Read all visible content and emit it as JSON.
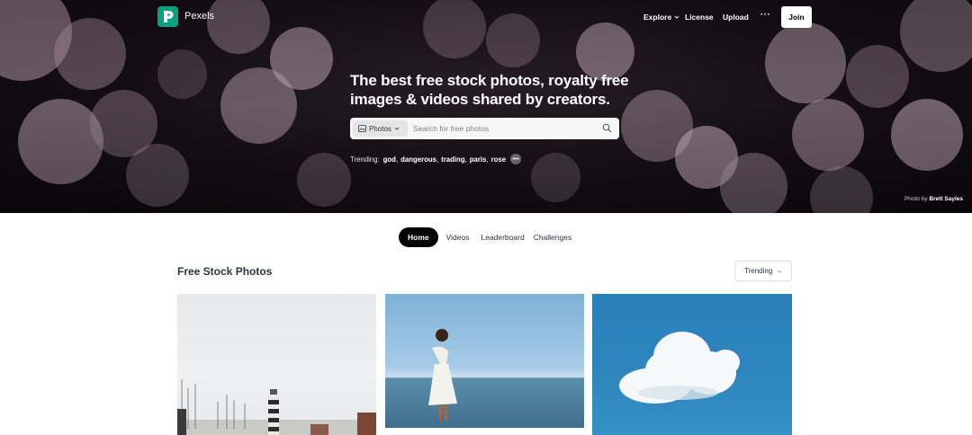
{
  "brand": {
    "name": "Pexels",
    "accent": "#07a081"
  },
  "nav": {
    "explore": "Explore",
    "license": "License",
    "upload": "Upload",
    "more": "···",
    "join": "Join"
  },
  "hero": {
    "title": "The best free stock photos, royalty free images & videos shared by creators.",
    "search": {
      "type_label": "Photos",
      "placeholder": "Search for free photos"
    },
    "trending": {
      "label": "Trending:",
      "terms": [
        "god",
        "dangerous",
        "trading",
        "paris",
        "rose"
      ]
    },
    "credit_prefix": "Photo by",
    "credit_name": "Brett Sayles"
  },
  "tabs": [
    {
      "label": "Home",
      "active": true
    },
    {
      "label": "Videos",
      "active": false
    },
    {
      "label": "Leaderboard",
      "active": false
    },
    {
      "label": "Challenges",
      "active": false
    }
  ],
  "section": {
    "title": "Free Stock Photos",
    "sort": "Trending"
  }
}
